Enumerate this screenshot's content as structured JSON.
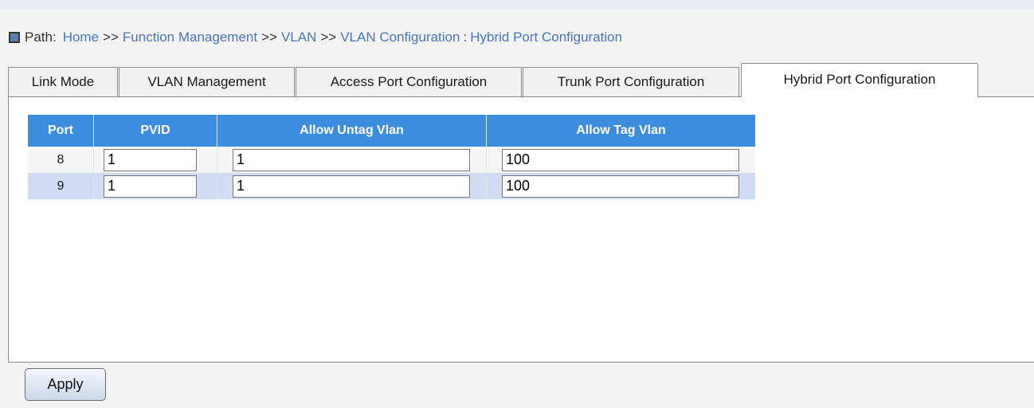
{
  "breadcrumb": {
    "label": "Path:",
    "links": [
      "Home",
      "Function Management",
      "VLAN",
      "VLAN Configuration"
    ],
    "separator": ">>",
    "colon": ":",
    "current": "Hybrid Port Configuration"
  },
  "tabs": [
    {
      "label": "Link Mode"
    },
    {
      "label": "VLAN Management"
    },
    {
      "label": "Access Port Configuration"
    },
    {
      "label": "Trunk Port Configuration"
    },
    {
      "label": "Hybrid Port Configuration",
      "active": true
    }
  ],
  "table": {
    "headers": [
      "Port",
      "PVID",
      "Allow Untag Vlan",
      "Allow Tag Vlan"
    ],
    "rows": [
      {
        "port": "8",
        "pvid": "1",
        "untag": "1",
        "tag": "100"
      },
      {
        "port": "9",
        "pvid": "1",
        "untag": "1",
        "tag": "100"
      }
    ]
  },
  "apply_label": "Apply",
  "colors": {
    "header_bg": "#3c8dde",
    "link": "#4a74c4",
    "row_alt": "#cfdcf4"
  }
}
